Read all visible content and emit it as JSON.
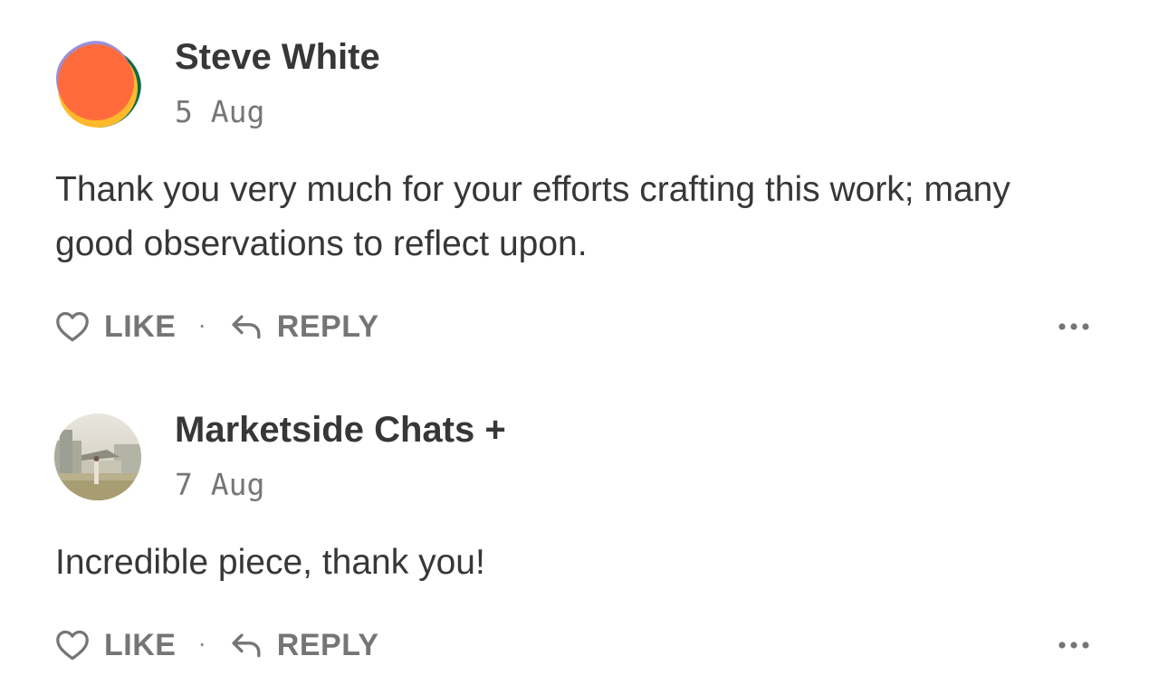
{
  "comments": [
    {
      "author": "Steve White",
      "date": "5 Aug",
      "text": "Thank you very much for your efforts crafting this work; many good observations to reflect upon.",
      "avatar_icon": "orange-circle-avatar",
      "like_label": "LIKE",
      "separator": "·",
      "reply_label": "REPLY",
      "more_icon": "ellipsis-icon"
    },
    {
      "author": "Marketside Chats +",
      "date": "7 Aug",
      "text": "Incredible piece, thank you!",
      "avatar_icon": "photo-avatar",
      "like_label": "LIKE",
      "separator": "·",
      "reply_label": "REPLY",
      "more_icon": "ellipsis-icon"
    }
  ],
  "colors": {
    "text": "#363737",
    "muted": "#767676",
    "action": "#757575",
    "avatar_orange": "#FF6B3D",
    "avatar_yellow": "#FFB92B",
    "avatar_green": "#0E6A4B",
    "avatar_purple": "#9B8FD6"
  }
}
